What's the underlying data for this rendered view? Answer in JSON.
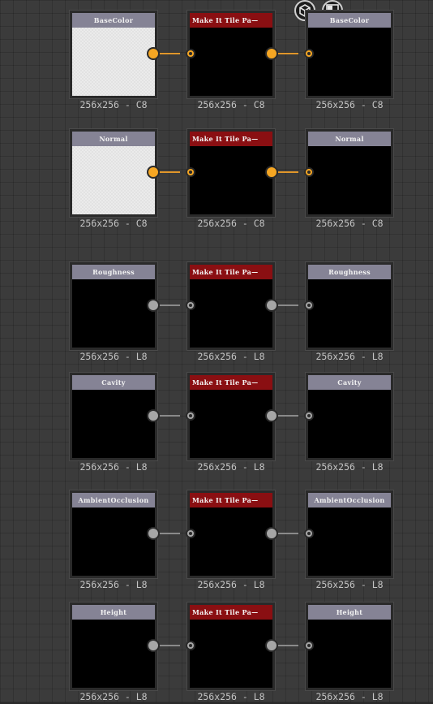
{
  "toolbar": {
    "buttons": [
      {
        "icon": "cube-icon"
      },
      {
        "icon": "checker-icon"
      }
    ]
  },
  "graph": {
    "filter_label": "Make It Tile Pa—",
    "rows": [
      {
        "channel": "BaseColor",
        "preview_in": "light",
        "link": "color",
        "res_in": "256x256 - C8",
        "res_filter": "256x256 - C8",
        "res_out": "256x256 - C8"
      },
      {
        "channel": "Normal",
        "preview_in": "light",
        "link": "color",
        "res_in": "256x256 - C8",
        "res_filter": "256x256 - C8",
        "res_out": "256x256 - C8"
      },
      {
        "channel": "Roughness",
        "preview_in": "dark",
        "link": "gray",
        "res_in": "256x256 - L8",
        "res_filter": "256x256 - L8",
        "res_out": "256x256 - L8"
      },
      {
        "channel": "Cavity",
        "preview_in": "dark",
        "link": "gray",
        "res_in": "256x256 - L8",
        "res_filter": "256x256 - L8",
        "res_out": "256x256 - L8"
      },
      {
        "channel": "AmbientOcclusion",
        "preview_in": "dark",
        "link": "gray",
        "res_in": "256x256 - L8",
        "res_filter": "256x256 - L8",
        "res_out": "256x256 - L8"
      },
      {
        "channel": "Height",
        "preview_in": "dark",
        "link": "gray",
        "res_in": "256x256 - L8",
        "res_filter": "256x256 - L8",
        "res_out": "256x256 - L8"
      }
    ]
  },
  "colors": {
    "link_color_port": "#f5a623",
    "link_gray_port": "#a6a6a6",
    "filter_header": "#8a0f12",
    "io_header": "#858395"
  }
}
